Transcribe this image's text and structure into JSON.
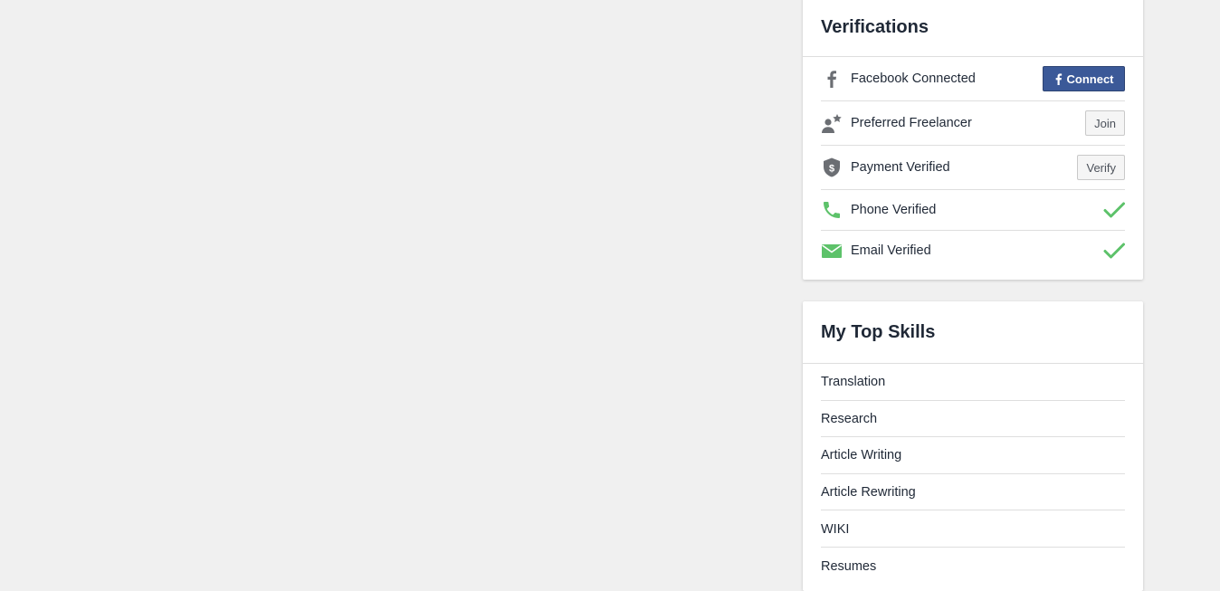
{
  "verifications": {
    "title": "Verifications",
    "items": [
      {
        "label": "Facebook Connected",
        "icon": "facebook-icon",
        "action": "Connect",
        "action_icon": "facebook-f-icon",
        "status": "action"
      },
      {
        "label": "Preferred Freelancer",
        "icon": "preferred-freelancer-icon",
        "action": "Join",
        "status": "action"
      },
      {
        "label": "Payment Verified",
        "icon": "shield-dollar-icon",
        "action": "Verify",
        "status": "action"
      },
      {
        "label": "Phone Verified",
        "icon": "phone-icon",
        "status": "verified",
        "status_icon": "checkmark-icon"
      },
      {
        "label": "Email Verified",
        "icon": "envelope-icon",
        "status": "verified",
        "status_icon": "checkmark-icon"
      }
    ]
  },
  "top_skills": {
    "title": "My Top Skills",
    "items": [
      "Translation",
      "Research",
      "Article Writing",
      "Article Rewriting",
      "WIKI",
      "Resumes"
    ]
  },
  "colors": {
    "background": "#f0f0f0",
    "facebook_blue": "#3b5998",
    "verified_green": "#5dc26a",
    "icon_gray": "#6b6e73",
    "text_dark": "#1f2836"
  }
}
